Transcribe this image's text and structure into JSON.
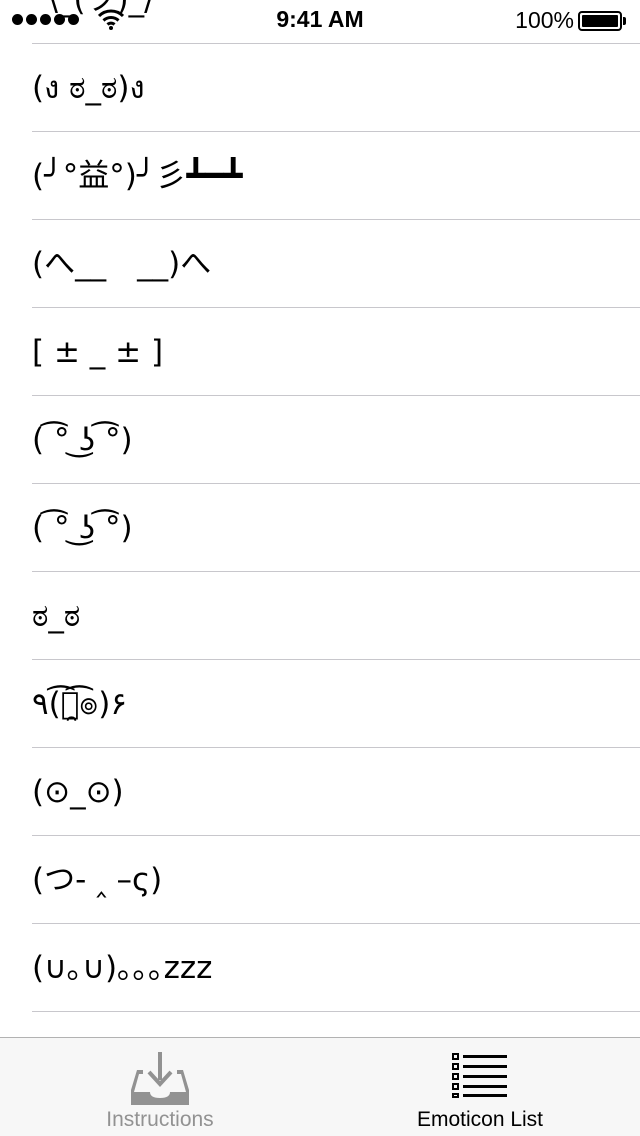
{
  "status_bar": {
    "time": "9:41 AM",
    "battery_percent": "100%",
    "battery_level": 1.0,
    "signal_bars": 5,
    "icons": [
      "signal-dots-icon",
      "wifi-icon",
      "battery-icon"
    ]
  },
  "emoticons": [
    "¯\\_(ツ)_/¯",
    "(ง ಠ_ಠ)ง",
    "(╯°益°)╯彡┻━┻",
    "(へ__　__)へ",
    "[ ± _ ± ]",
    "( ͡° ͜ʖ ͡°)",
    "( ͡° ͜ʖ ͡°)",
    "ಠ_ಠ",
    "٩(͡๏̯͡๏)۶",
    "(⊙_⊙)",
    "(つ- ‸ –ς)",
    "(∪｡∪)｡｡｡zzz"
  ],
  "tab_bar": {
    "tabs": [
      {
        "label": "Instructions",
        "icon": "tray-download-icon",
        "active": false
      },
      {
        "label": "Emoticon List",
        "icon": "list-icon",
        "active": true
      }
    ],
    "colors": {
      "active": "#000000",
      "inactive": "#929292",
      "background": "#f7f7f7"
    }
  }
}
